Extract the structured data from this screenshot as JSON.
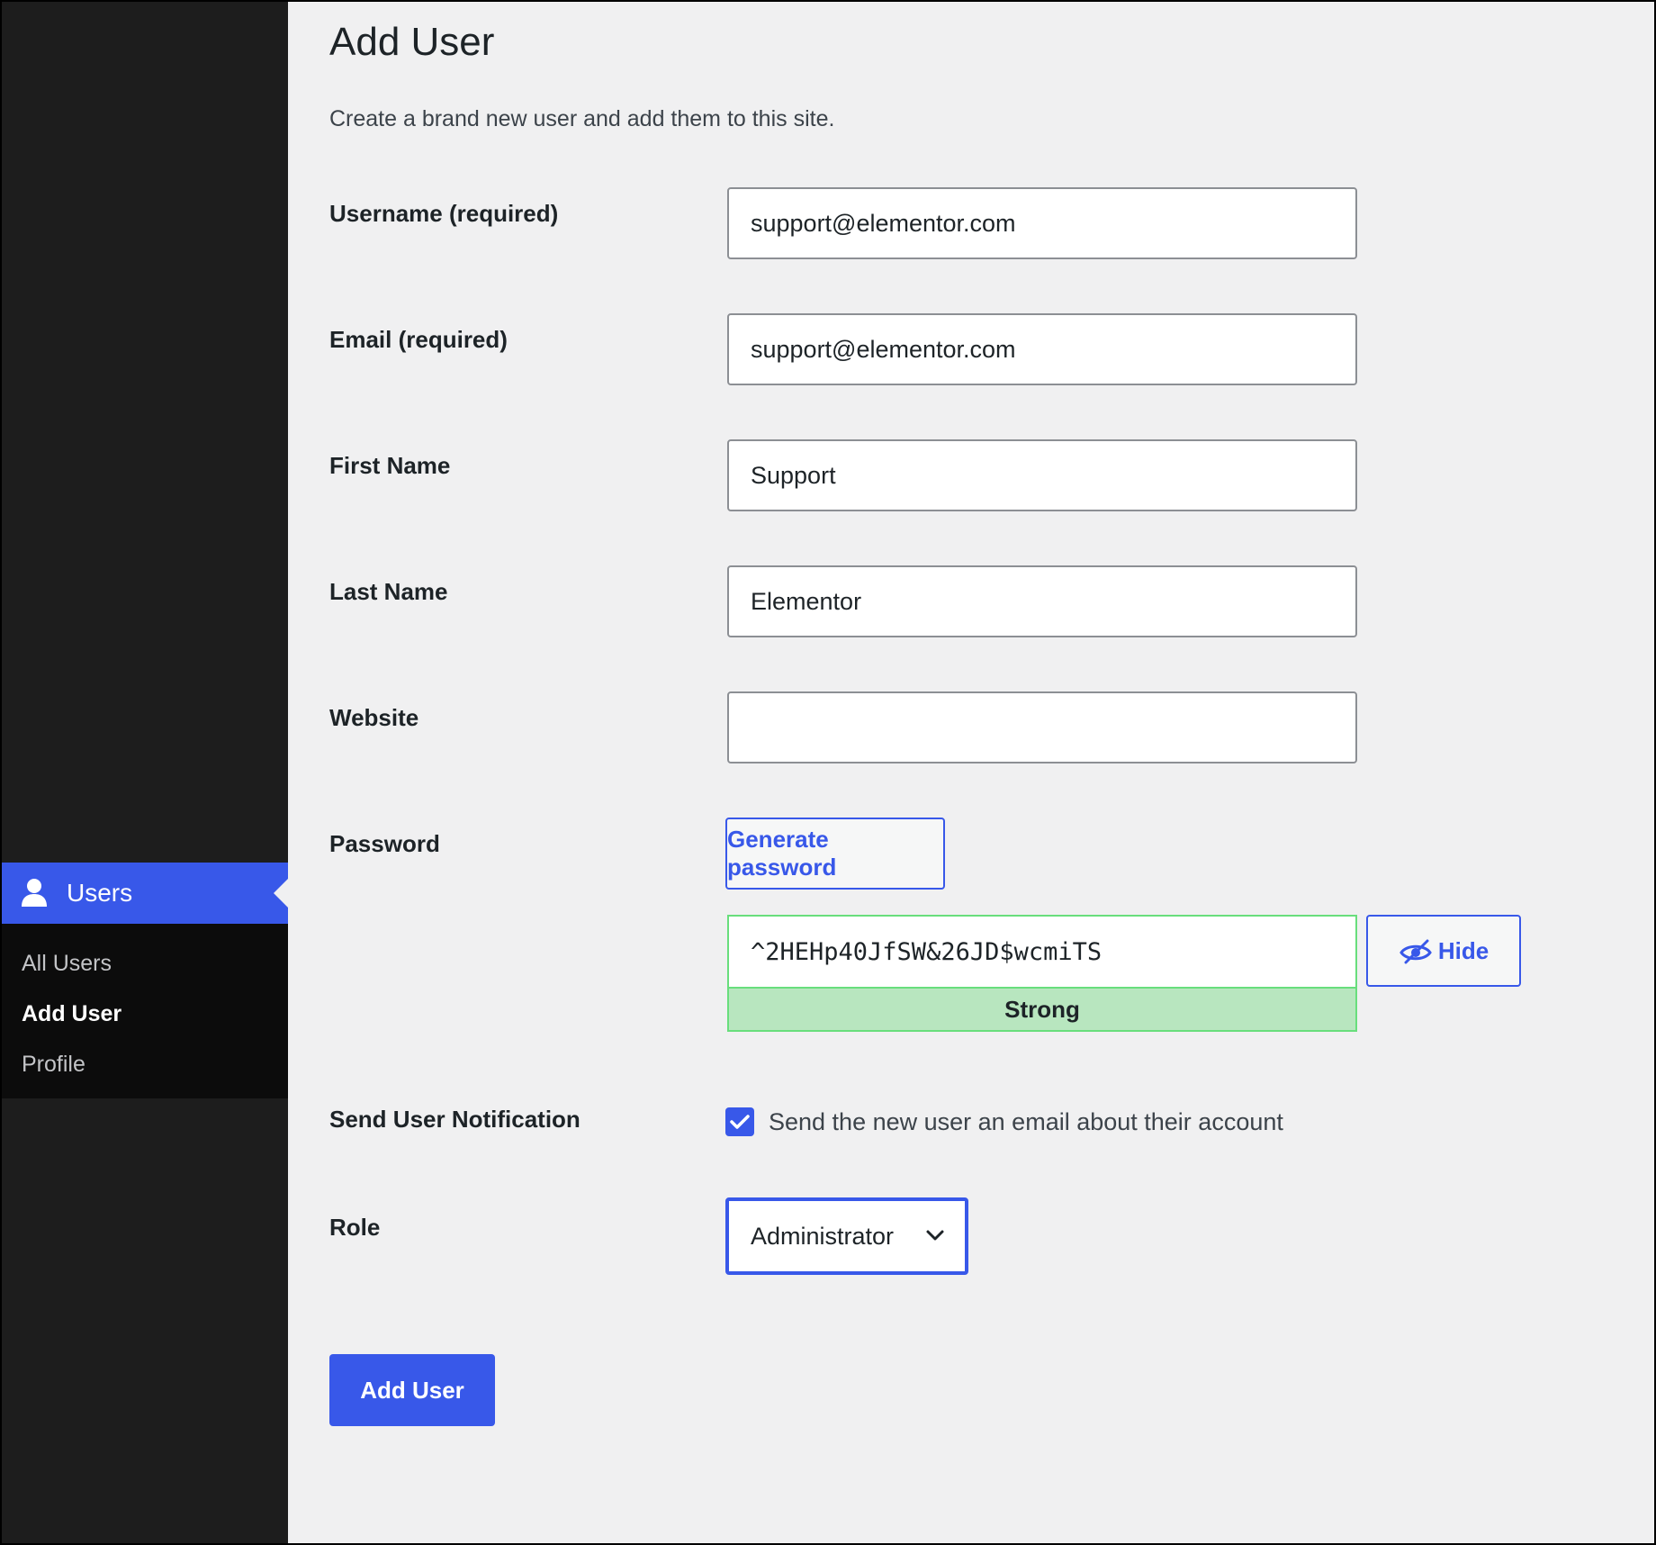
{
  "sidebar": {
    "active_menu": {
      "label": "Users",
      "icon": "user-icon"
    },
    "submenu": [
      {
        "label": "All Users",
        "current": false
      },
      {
        "label": "Add User",
        "current": true
      },
      {
        "label": "Profile",
        "current": false
      }
    ]
  },
  "main": {
    "title": "Add User",
    "description": "Create a brand new user and add them to this site.",
    "fields": {
      "username": {
        "label": "Username (required)",
        "value": "support@elementor.com"
      },
      "email": {
        "label": "Email (required)",
        "value": "support@elementor.com"
      },
      "first_name": {
        "label": "First Name",
        "value": "Support"
      },
      "last_name": {
        "label": "Last Name",
        "value": "Elementor"
      },
      "website": {
        "label": "Website",
        "value": ""
      },
      "password": {
        "label": "Password",
        "generate_label": "Generate password",
        "value": "^2HEHp40JfSW&26JD$wcmiTS",
        "strength": "Strong",
        "toggle_label": "Hide"
      },
      "notification": {
        "label": "Send User Notification",
        "checkbox_text": "Send the new user an email about their account",
        "checked": true
      },
      "role": {
        "label": "Role",
        "value": "Administrator"
      }
    },
    "submit_label": "Add User"
  },
  "colors": {
    "accent": "#3858e9",
    "sidebar_bg": "#1d1d1d",
    "submenu_bg": "#0c0c0c",
    "content_bg": "#f0f0f1",
    "strength_bg": "#b8e6bf",
    "strength_border": "#68de7c"
  }
}
